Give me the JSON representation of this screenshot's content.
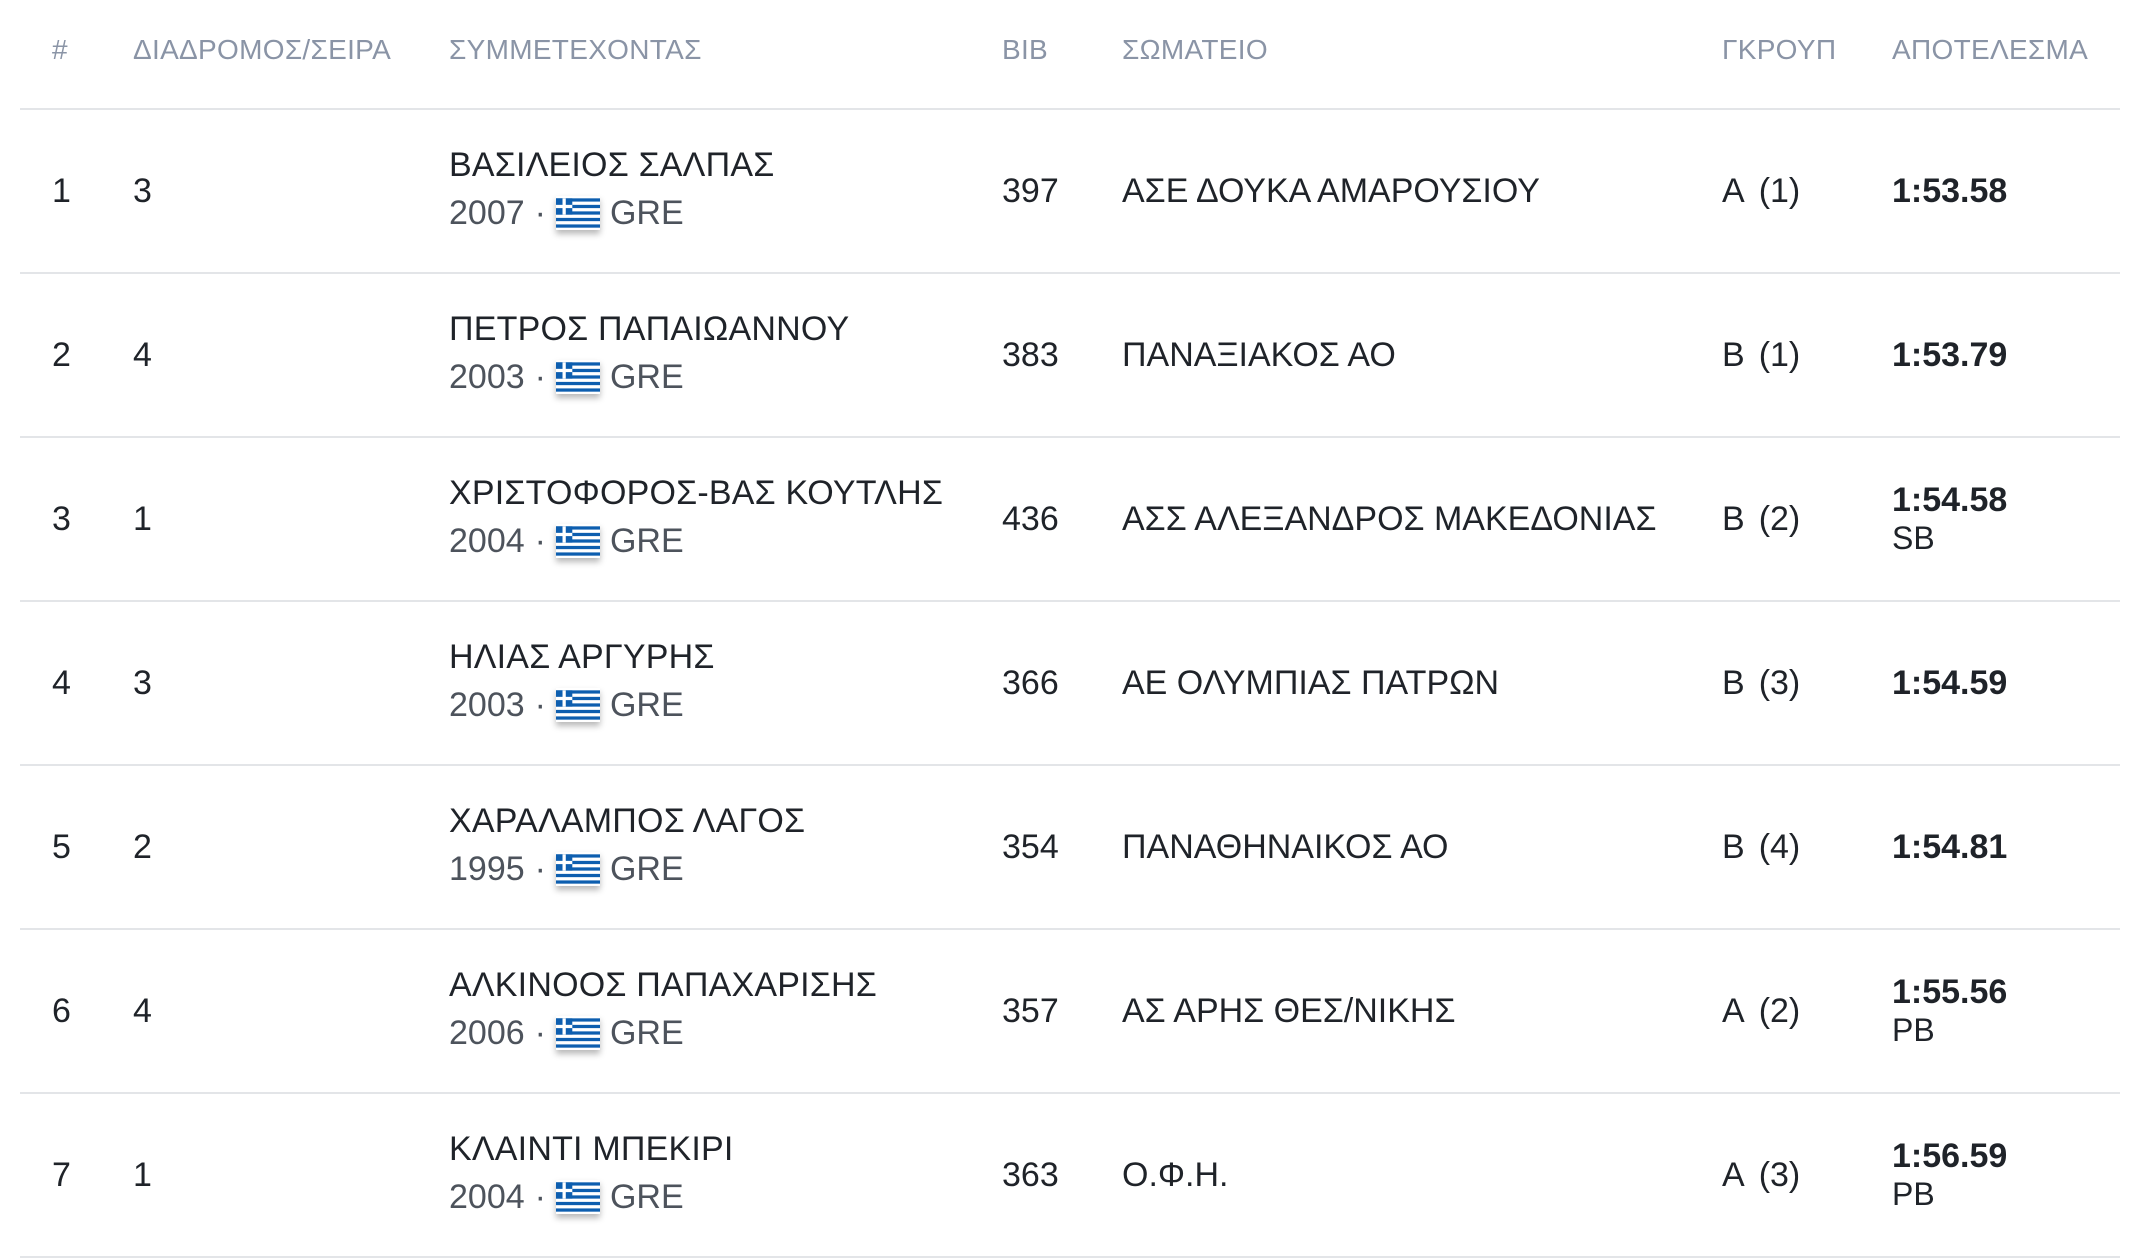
{
  "headers": {
    "rank": "#",
    "lane": "ΔΙΑΔΡΟΜΟΣ/ΣΕΙΡΑ",
    "athlete": "ΣΥΜΜΕΤΕΧΟΝΤΑΣ",
    "bib": "BIB",
    "club": "ΣΩΜΑΤΕΙΟ",
    "group": "ΓΚΡΟΥΠ",
    "result": "ΑΠΟΤΕΛΕΣΜΑ"
  },
  "flag_icon": "greece-flag-icon",
  "colors": {
    "header_text": "#8a94a6",
    "body_text": "#1f2329",
    "meta_text": "#4d535c",
    "divider": "#e3e5e8",
    "flag_blue": "#0d5eaf"
  },
  "rows": [
    {
      "rank": "1",
      "lane": "3",
      "name": "ΒΑΣΙΛΕΙΟΣ ΣΑΛΠΑΣ",
      "year": "2007",
      "dot": "·",
      "country": "GRE",
      "bib": "397",
      "club": "ΑΣΕ ΔΟΥΚΑ ΑΜΑΡΟΥΣΙΟΥ",
      "group": "Α",
      "group_pos": "(1)",
      "time": "1:53.58",
      "note": ""
    },
    {
      "rank": "2",
      "lane": "4",
      "name": "ΠΕΤΡΟΣ ΠΑΠΑΙΩΑΝΝΟΥ",
      "year": "2003",
      "dot": "·",
      "country": "GRE",
      "bib": "383",
      "club": "ΠΑΝΑΞΙΑΚΟΣ ΑΟ",
      "group": "Β",
      "group_pos": "(1)",
      "time": "1:53.79",
      "note": ""
    },
    {
      "rank": "3",
      "lane": "1",
      "name": "ΧΡΙΣΤΟΦΟΡΟΣ-ΒΑΣ ΚΟΥΤΛΗΣ",
      "year": "2004",
      "dot": "·",
      "country": "GRE",
      "bib": "436",
      "club": "ΑΣΣ ΑΛΕΞΑΝΔΡΟΣ ΜΑΚΕΔΟΝΙΑΣ",
      "group": "Β",
      "group_pos": "(2)",
      "time": "1:54.58",
      "note": "SB"
    },
    {
      "rank": "4",
      "lane": "3",
      "name": "ΗΛΙΑΣ ΑΡΓΥΡΗΣ",
      "year": "2003",
      "dot": "·",
      "country": "GRE",
      "bib": "366",
      "club": "ΑΕ ΟΛΥΜΠΙΑΣ ΠΑΤΡΩΝ",
      "group": "Β",
      "group_pos": "(3)",
      "time": "1:54.59",
      "note": ""
    },
    {
      "rank": "5",
      "lane": "2",
      "name": "ΧΑΡΑΛΑΜΠΟΣ ΛΑΓΟΣ",
      "year": "1995",
      "dot": "·",
      "country": "GRE",
      "bib": "354",
      "club": "ΠΑΝΑΘΗΝΑΙΚΟΣ ΑΟ",
      "group": "Β",
      "group_pos": "(4)",
      "time": "1:54.81",
      "note": ""
    },
    {
      "rank": "6",
      "lane": "4",
      "name": "ΑΛΚΙΝΟΟΣ ΠΑΠΑΧΑΡΙΣΗΣ",
      "year": "2006",
      "dot": "·",
      "country": "GRE",
      "bib": "357",
      "club": "ΑΣ ΑΡΗΣ ΘΕΣ/ΝΙΚΗΣ",
      "group": "Α",
      "group_pos": "(2)",
      "time": "1:55.56",
      "note": "PB"
    },
    {
      "rank": "7",
      "lane": "1",
      "name": "ΚΛΑΙΝΤΙ ΜΠΕΚΙΡΙ",
      "year": "2004",
      "dot": "·",
      "country": "GRE",
      "bib": "363",
      "club": "Ο.Φ.Η.",
      "group": "Α",
      "group_pos": "(3)",
      "time": "1:56.59",
      "note": "PB"
    }
  ]
}
